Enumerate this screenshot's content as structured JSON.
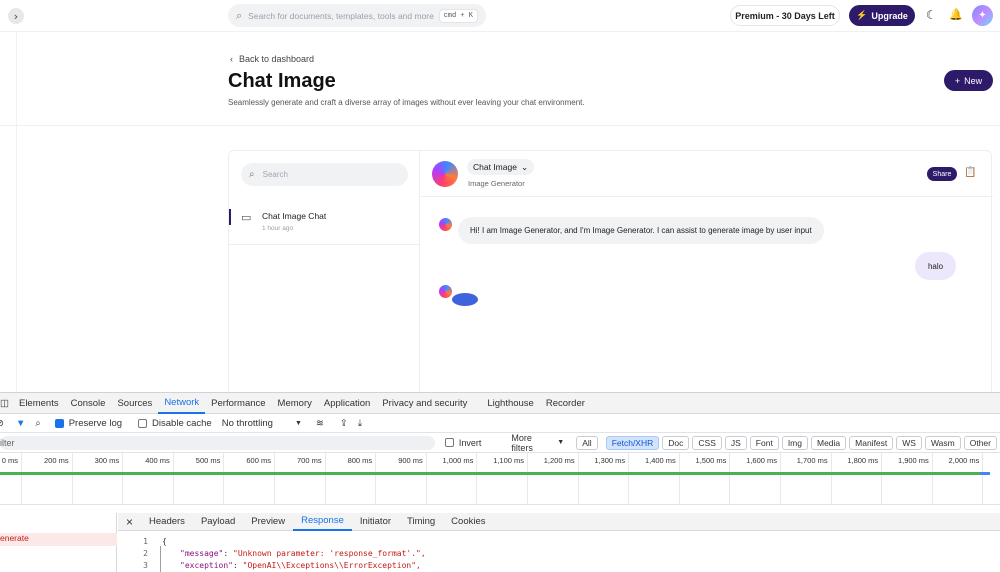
{
  "topbar": {
    "expand_icon": "chevron-right-icon",
    "search_placeholder": "Search for documents, templates, tools and more",
    "search_shortcut": "cmd + K",
    "premium_label": "Premium - 30 Days Left",
    "upgrade_label": "Upgrade"
  },
  "header": {
    "back_label": "Back to dashboard",
    "title": "Chat Image",
    "subtitle": "Seamlessly generate and craft a diverse array of images without ever leaving your chat environment.",
    "new_button_label": "New"
  },
  "sidebar": {
    "search_placeholder": "Search",
    "conversations": [
      {
        "title": "Chat Image Chat",
        "time": "1 hour ago"
      }
    ]
  },
  "chat": {
    "model_label": "Chat Image",
    "model_subtitle": "Image Generator",
    "share_label": "Share",
    "messages": [
      {
        "role": "bot",
        "text": "Hi! I am Image Generator, and I'm Image Generator. I can assist to generate image by user input"
      },
      {
        "role": "user",
        "text": "halo"
      }
    ]
  },
  "devtools": {
    "tabs": [
      "Elements",
      "Console",
      "Sources",
      "Network",
      "Performance",
      "Memory",
      "Application",
      "Privacy and security",
      "Lighthouse",
      "Recorder"
    ],
    "active_tab": "Network",
    "toolbar": {
      "preserve_log": "Preserve log",
      "preserve_log_checked": true,
      "disable_cache": "Disable cache",
      "disable_cache_checked": false,
      "throttling": "No throttling"
    },
    "filter": {
      "placeholder": "ilter",
      "invert_label": "Invert",
      "more_filters": "More filters",
      "types": [
        "All",
        "Fetch/XHR",
        "Doc",
        "CSS",
        "JS",
        "Font",
        "Img",
        "Media",
        "Manifest",
        "WS",
        "Wasm",
        "Other"
      ],
      "active_type": "Fetch/XHR"
    },
    "timeline_ticks": [
      "0 ms",
      "200 ms",
      "300 ms",
      "400 ms",
      "500 ms",
      "600 ms",
      "700 ms",
      "800 ms",
      "900 ms",
      "1,000 ms",
      "1,100 ms",
      "1,200 ms",
      "1,300 ms",
      "1,400 ms",
      "1,500 ms",
      "1,600 ms",
      "1,700 ms",
      "1,800 ms",
      "1,900 ms",
      "2,000 ms"
    ],
    "request_name": "enerate",
    "detail_tabs": [
      "Headers",
      "Payload",
      "Preview",
      "Response",
      "Initiator",
      "Timing",
      "Cookies"
    ],
    "active_detail_tab": "Response",
    "response_lines": [
      {
        "n": "1",
        "text": "{"
      },
      {
        "n": "2",
        "key": "\"message\"",
        "value": "\"Unknown parameter: 'response_format'.\","
      },
      {
        "n": "3",
        "key": "\"exception\"",
        "value": "\"OpenAI\\\\Exceptions\\\\ErrorException\","
      }
    ]
  }
}
